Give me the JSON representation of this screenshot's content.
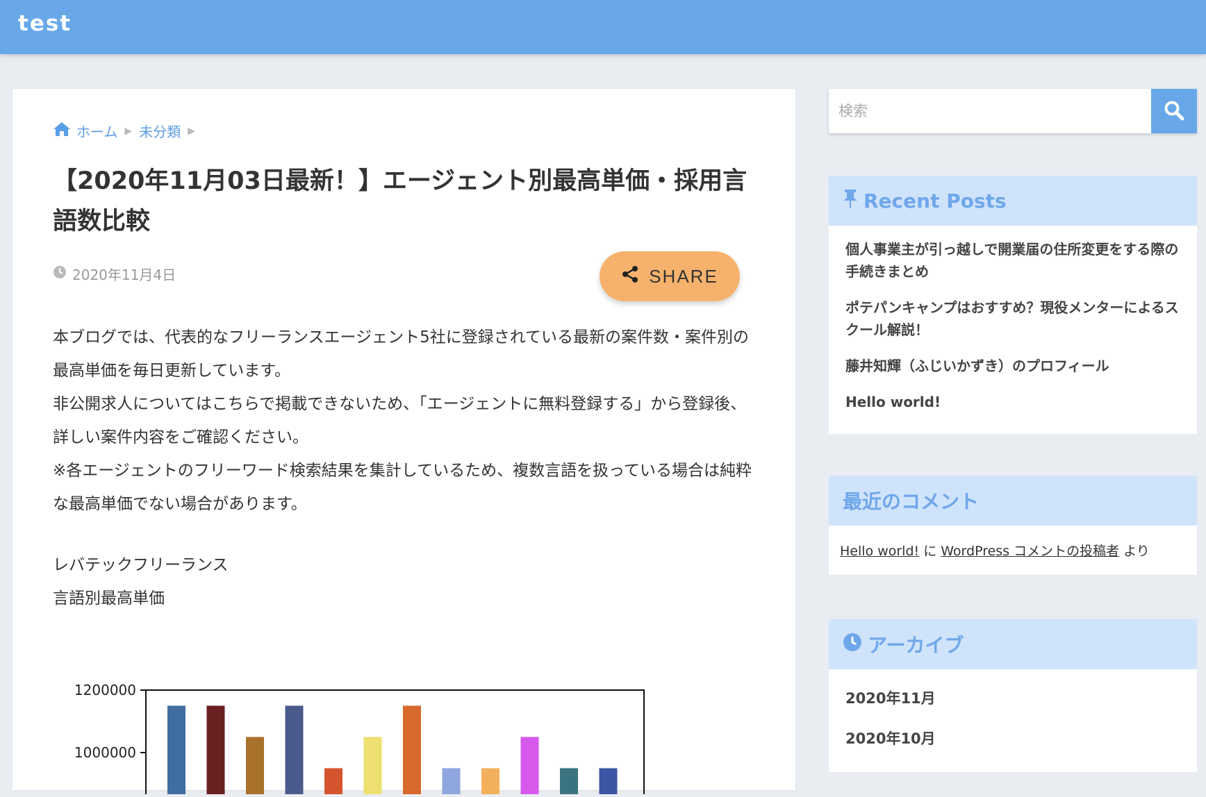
{
  "header": {
    "site_title": "test"
  },
  "breadcrumb": {
    "home": "ホーム",
    "category": "未分類"
  },
  "post": {
    "title": "【2020年11月03日最新！】エージェント別最高単価・採用言語数比較",
    "date": "2020年11月4日",
    "share_label": "SHARE",
    "paragraphs": [
      "本ブログでは、代表的なフリーランスエージェント5社に登録されている最新の案件数・案件別の最高単価を毎日更新しています。",
      "非公開求人についてはこちらで掲載できないため、「エージェントに無料登録する」から登録後、詳しい案件内容をご確認ください。",
      "※各エージェントのフリーワード検索結果を集計しているため、複数言語を扱っている場合は純粋な最高単価でない場合があります。"
    ],
    "section_lines": [
      "レバテックフリーランス",
      "言語別最高単価"
    ]
  },
  "sidebar": {
    "search_placeholder": "検索",
    "recent_posts": {
      "title": "Recent Posts",
      "items": [
        "個人事業主が引っ越しで開業届の住所変更をする際の手続きまとめ",
        "ポテパンキャンプはおすすめ？現役メンターによるスクール解説！",
        "藤井知輝（ふじいかずき）のプロフィール",
        "Hello world!"
      ]
    },
    "recent_comments": {
      "title": "最近のコメント",
      "post_link": "Hello world!",
      "connector": "に",
      "author_link": "WordPress コメントの投稿者",
      "suffix": "より"
    },
    "archives": {
      "title": "アーカイブ",
      "items": [
        "2020年11月",
        "2020年10月"
      ]
    }
  },
  "colors": {
    "header": "#68a8e9",
    "accent": "#5c9ee6",
    "share": "#f6b26c",
    "widget_head": "#cfe3fb"
  },
  "chart_data": {
    "type": "bar",
    "y_ticks": [
      1200000,
      1000000
    ],
    "ylim_visible": [
      850000,
      1200000
    ],
    "values": [
      1150000,
      1150000,
      1050000,
      1150000,
      950000,
      1050000,
      1150000,
      950000,
      950000,
      1050000,
      950000,
      950000
    ],
    "colors": [
      "#3f6ea0",
      "#6b2022",
      "#a8722d",
      "#4b5a8c",
      "#d4552e",
      "#ede070",
      "#d8692c",
      "#8fa6de",
      "#f2b05c",
      "#d659ec",
      "#3a737f",
      "#3b56a2"
    ]
  }
}
